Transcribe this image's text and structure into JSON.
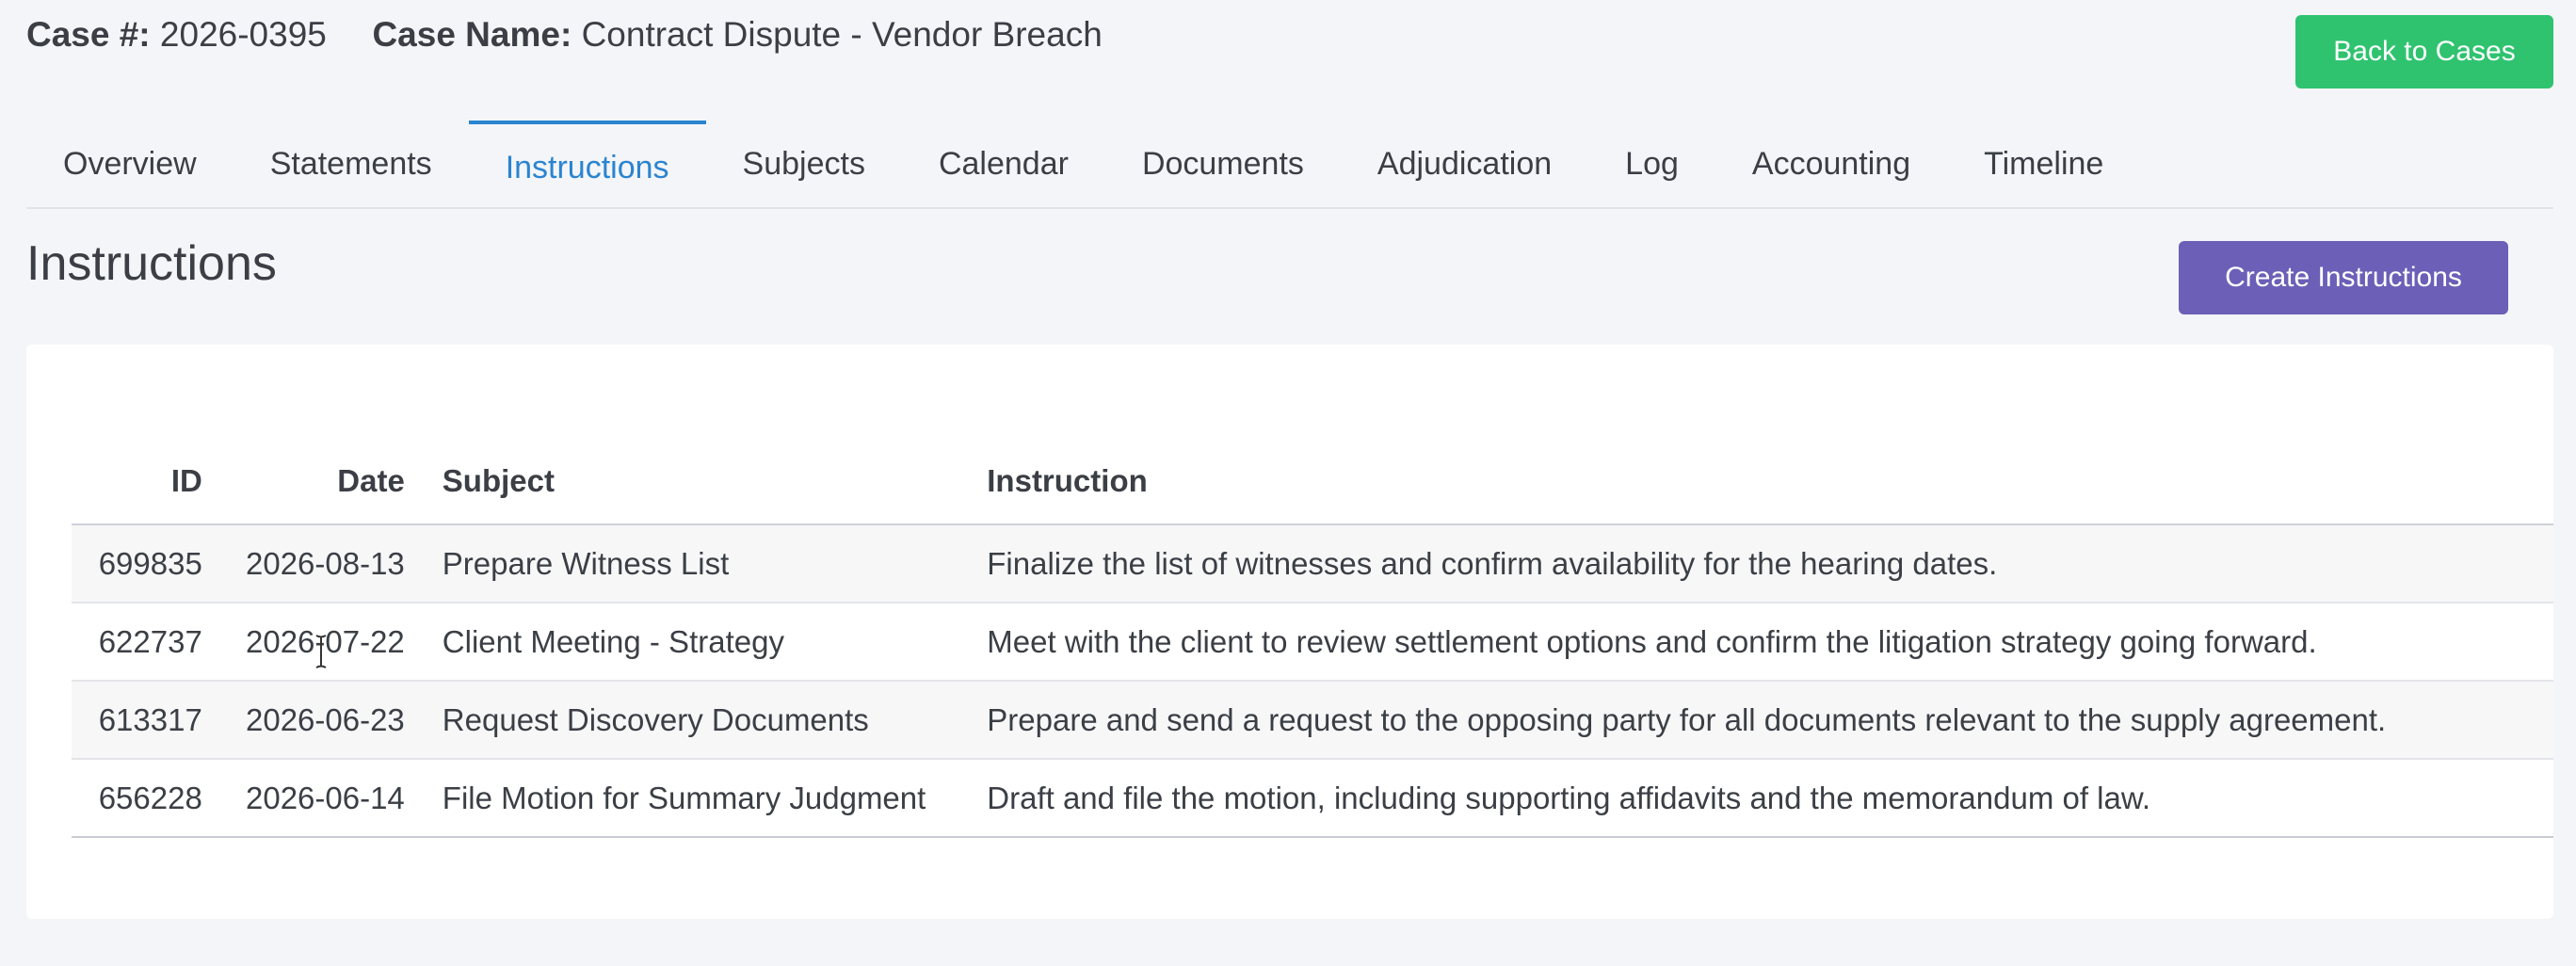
{
  "header": {
    "case_number_label": "Case #:",
    "case_number": "2026-0395",
    "case_name_label": "Case Name:",
    "case_name": "Contract Dispute - Vendor Breach",
    "back_button": "Back to Cases"
  },
  "tabs": [
    {
      "label": "Overview"
    },
    {
      "label": "Statements"
    },
    {
      "label": "Instructions",
      "active": true
    },
    {
      "label": "Subjects"
    },
    {
      "label": "Calendar"
    },
    {
      "label": "Documents"
    },
    {
      "label": "Adjudication"
    },
    {
      "label": "Log"
    },
    {
      "label": "Accounting"
    },
    {
      "label": "Timeline"
    }
  ],
  "page": {
    "title": "Instructions",
    "create_button": "Create Instructions"
  },
  "table": {
    "columns": [
      "ID",
      "Date",
      "Subject",
      "Instruction"
    ],
    "rows": [
      {
        "id": "699835",
        "date": "2026-08-13",
        "subject": "Prepare Witness List",
        "instruction": "Finalize the list of witnesses and confirm availability for the hearing dates."
      },
      {
        "id": "622737",
        "date": "2026-07-22",
        "subject": "Client Meeting - Strategy",
        "instruction": "Meet with the client to review settlement options and confirm the litigation strategy going forward."
      },
      {
        "id": "613317",
        "date": "2026-06-23",
        "subject": "Request Discovery Documents",
        "instruction": "Prepare and send a request to the opposing party for all documents relevant to the supply agreement."
      },
      {
        "id": "656228",
        "date": "2026-06-14",
        "subject": "File Motion for Summary Judgment",
        "instruction": "Draft and file the motion, including supporting affidavits and the memorandum of law."
      }
    ]
  },
  "colors": {
    "accent_tab": "#2b84d0",
    "back_button": "#2fc36f",
    "create_button": "#6b5fb7"
  }
}
